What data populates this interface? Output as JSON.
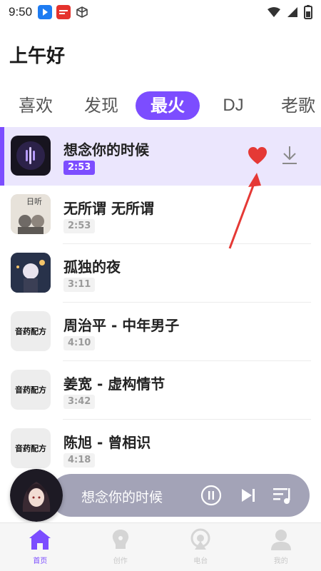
{
  "status_bar": {
    "time": "9:50",
    "notification_icons": [
      "blue-arrow-app-icon",
      "red-news-app-icon",
      "cube-app-icon"
    ],
    "system_icons": [
      "wifi-icon",
      "signal-icon",
      "battery-icon"
    ]
  },
  "greeting": "上午好",
  "tabs": [
    {
      "label": "喜欢",
      "active": false
    },
    {
      "label": "发现",
      "active": false
    },
    {
      "label": "最火",
      "active": true
    },
    {
      "label": "DJ",
      "active": false
    },
    {
      "label": "老歌",
      "active": false
    }
  ],
  "songs": [
    {
      "title": "想念你的时候",
      "duration": "2:53",
      "active": true,
      "liked": true,
      "cover_text": ""
    },
    {
      "title": "无所谓 无所谓",
      "duration": "2:53",
      "active": false,
      "cover_text": "日听"
    },
    {
      "title": "孤独的夜",
      "duration": "3:11",
      "active": false,
      "cover_text": ""
    },
    {
      "title": "周治平 - 中年男子",
      "duration": "4:10",
      "active": false,
      "cover_text": "音药配方"
    },
    {
      "title": "姜宽 - 虚构情节",
      "duration": "3:42",
      "active": false,
      "cover_text": "音药配方"
    },
    {
      "title": "陈旭 - 曾相识",
      "duration": "4:18",
      "active": false,
      "cover_text": "音药配方"
    }
  ],
  "player": {
    "now_playing": "想念你的时候",
    "controls": [
      "pause-icon",
      "next-icon",
      "playlist-icon"
    ]
  },
  "bottom_nav": [
    {
      "label": "首页",
      "icon": "home-icon",
      "active": true
    },
    {
      "label": "创作",
      "icon": "create-icon",
      "active": false
    },
    {
      "label": "电台",
      "icon": "radio-icon",
      "active": false
    },
    {
      "label": "我的",
      "icon": "profile-icon",
      "active": false
    }
  ],
  "colors": {
    "accent": "#7c4dff",
    "active_row_bg": "#ebe6fd",
    "like_red": "#e53935",
    "player_bg": "#a3a3b7"
  }
}
